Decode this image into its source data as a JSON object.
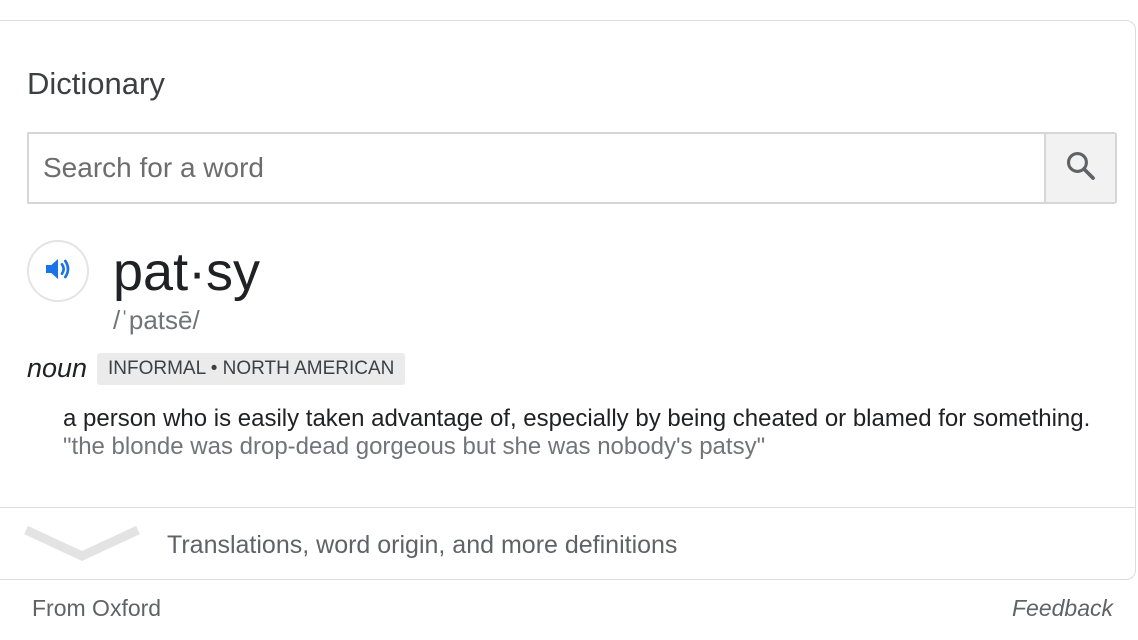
{
  "card": {
    "title": "Dictionary",
    "search": {
      "placeholder": "Search for a word",
      "value": "",
      "button_icon": "search-icon"
    },
    "entry": {
      "audio_icon": "speaker-icon",
      "word": "pat·sy",
      "pronunciation": "/ˈpatsē/",
      "part_of_speech": "noun",
      "labels": "INFORMAL • NORTH AMERICAN",
      "definition": "a person who is easily taken advantage of, especially by being cheated or blamed for something.",
      "example": "\"the blonde was drop-dead gorgeous but she was nobody's patsy\""
    },
    "more": {
      "icon": "chevron-down-icon",
      "label": "Translations, word origin, and more definitions"
    }
  },
  "footer": {
    "source": "From Oxford",
    "feedback": "Feedback"
  },
  "colors": {
    "accent_blue": "#1a73e8",
    "text_primary": "#202124",
    "text_secondary": "#70757a",
    "label_bg": "#ebebeb",
    "border": "#dadce0"
  }
}
